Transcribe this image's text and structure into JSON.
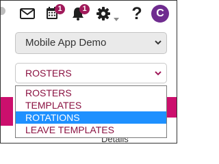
{
  "toolbar": {
    "icons": [
      "mail-icon",
      "calendar-icon",
      "bell-icon",
      "gear-icon",
      "help-icon"
    ],
    "calendar_badge": "1",
    "notifications_badge": "1",
    "help_label": "?",
    "avatar_initial": "C"
  },
  "org_select": {
    "value": "Mobile App Demo"
  },
  "view_select": {
    "value": "ROSTERS",
    "options": [
      "ROSTERS",
      "TEMPLATES",
      "ROTATIONS",
      "LEAVE TEMPLATES"
    ],
    "highlighted": "ROTATIONS"
  },
  "background": {
    "details_label": "Details"
  },
  "colors": {
    "accent": "#a0195a",
    "brand_magenta": "#cc0f6d",
    "avatar": "#6f2c8f",
    "highlight": "#1e90ff",
    "option_text": "#8a1040"
  }
}
